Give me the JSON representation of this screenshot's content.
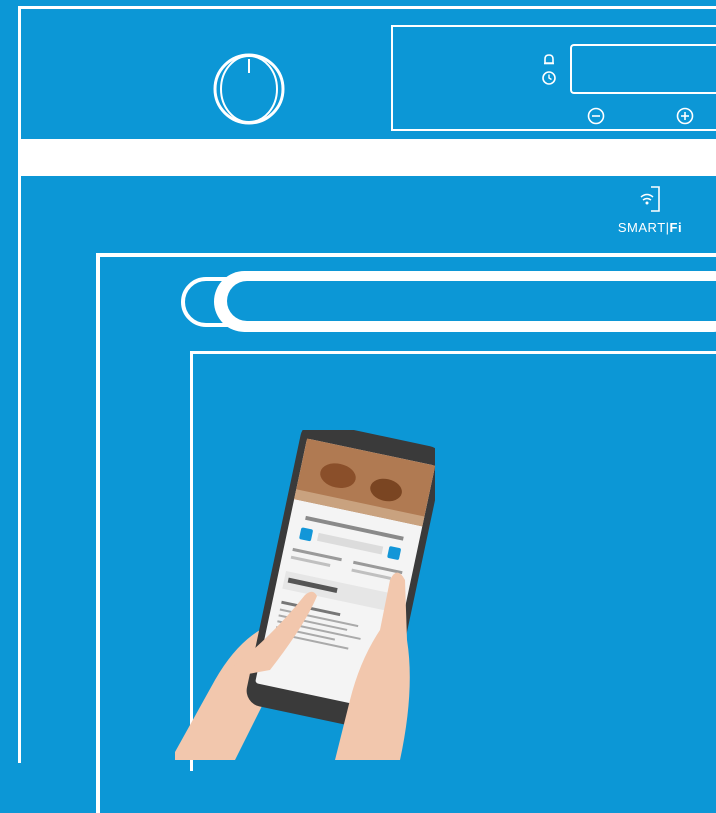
{
  "control_panel": {
    "knob_icon": "rotary-knob-icon",
    "alarm_icon": "bell-icon",
    "clock_icon": "clock-icon",
    "minus_icon": "minus-circle-icon",
    "plus_icon": "plus-circle-icon"
  },
  "smartfi": {
    "icon": "wifi-door-icon",
    "label_light": "SMART",
    "label_bold": "Fi"
  },
  "colors": {
    "background": "#0c97d6",
    "lines": "#ffffff",
    "skin": "#f2c7ad",
    "phone_body": "#3a3a3a"
  }
}
